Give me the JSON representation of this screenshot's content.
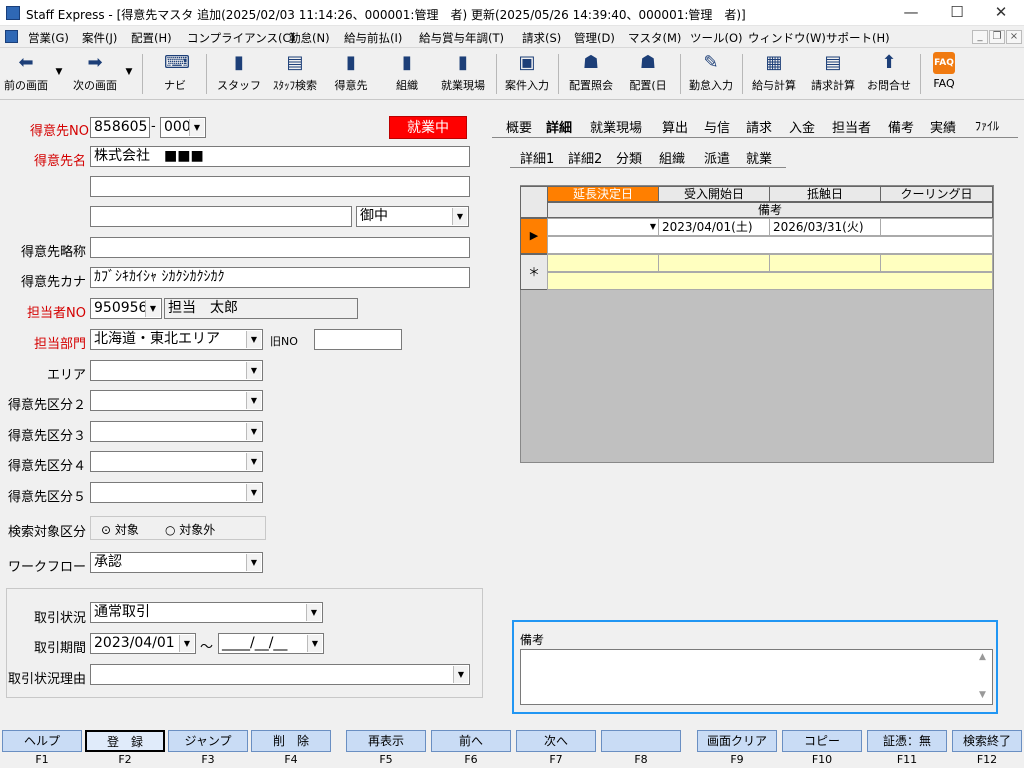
{
  "window": {
    "title": "Staff Express - [得意先マスタ 追加(2025/02/03 11:14:26、000001:管理　者) 更新(2025/05/26 14:39:40、000001:管理　者)]",
    "minimize": "—",
    "maximize": "☐",
    "close": "✕"
  },
  "menu": [
    "営業(G)",
    "案件(J)",
    "配置(H)",
    "コンプライアンス(C)",
    "勤怠(N)",
    "給与前払(I)",
    "給与賞与年調(T)",
    "請求(S)",
    "管理(D)",
    "マスタ(M)",
    "ツール(O)",
    "ウィンドウ(W)",
    "サポート(H)"
  ],
  "mdi": {
    "min": "_",
    "restore": "❐",
    "close": "×"
  },
  "toolbar": {
    "back": "前の画面",
    "forward": "次の画面",
    "navi": "ナビ",
    "staff": "スタッフ",
    "staff_search": "ｽﾀｯﾌ検索",
    "customer": "得意先",
    "org": "組織",
    "site": "就業現場",
    "job_input": "案件入力",
    "assign_view": "配置照会",
    "assign_day": "配置(日",
    "attendance": "勤怠入力",
    "payroll": "給与計算",
    "billing": "請求計算",
    "inquiry": "お問合せ",
    "faq": "FAQ",
    "faq_badge": "FAQ"
  },
  "form": {
    "cust_no_label": "得意先NO",
    "cust_no": "858605",
    "cust_sub": "000",
    "status_badge": "就業中",
    "name_label": "得意先名",
    "name": "株式会社　■■■",
    "name2": "",
    "name3": "",
    "honorific": "御中",
    "short_label": "得意先略称",
    "short": "",
    "kana_label": "得意先カナ",
    "kana": "ｶﾌﾞｼｷｶｲｼｬ ｼｶｸｼｶｸｼｶｸ",
    "rep_label": "担当者NO",
    "rep_no": "950956",
    "rep_name": "担当　太郎",
    "dept_label": "担当部門",
    "dept": "北海道・東北エリア",
    "old_no_label": "旧NO",
    "old_no": "",
    "area_label": "エリア",
    "cat2_label": "得意先区分２",
    "cat3_label": "得意先区分３",
    "cat4_label": "得意先区分４",
    "cat5_label": "得意先区分５",
    "search_label": "検索対象区分",
    "search_on": "対象",
    "search_off": "対象外",
    "workflow_label": "ワークフロー",
    "workflow": "承認",
    "deal_status_label": "取引状況",
    "deal_status": "通常取引",
    "deal_period_label": "取引期間",
    "deal_from": "2023/04/01",
    "tilde": "～",
    "deal_to": "____/__/__",
    "deal_reason_label": "取引状況理由",
    "deal_reason": ""
  },
  "tabs": [
    "概要",
    "詳細",
    "就業現場",
    "算出",
    "与信",
    "請求",
    "入金",
    "担当者",
    "備考",
    "実績",
    "ﾌｧｲﾙ"
  ],
  "subtabs": [
    "詳細1",
    "詳細2",
    "分類",
    "組織",
    "派遣",
    "就業"
  ],
  "grid": {
    "headers": [
      "延長決定日",
      "受入開始日",
      "抵触日",
      "クーリング日"
    ],
    "sub_header": "備考",
    "row": {
      "extend": "",
      "start": "2023/04/01(土)",
      "conflict": "2026/03/31(火)",
      "cooling": ""
    },
    "new_marker": "＊",
    "current_marker": "▶"
  },
  "remarks": {
    "label": "備考",
    "value": ""
  },
  "fkeys": [
    {
      "label": "ヘルプ",
      "key": "F1"
    },
    {
      "label": "登　録",
      "key": "F2"
    },
    {
      "label": "ジャンプ",
      "key": "F3"
    },
    {
      "label": "削　除",
      "key": "F4"
    },
    {
      "label": "再表示",
      "key": "F5"
    },
    {
      "label": "前へ",
      "key": "F6"
    },
    {
      "label": "次へ",
      "key": "F7"
    },
    {
      "label": "",
      "key": "F8"
    },
    {
      "label": "画面クリア",
      "key": "F9"
    },
    {
      "label": "コピー",
      "key": "F10"
    },
    {
      "label": "証憑：無",
      "key": "F11"
    },
    {
      "label": "検索終了",
      "key": "F12"
    }
  ],
  "colors": {
    "status_bg": "#ff0000",
    "selected_header": "#ff7f00",
    "new_row": "#ffffc0",
    "fkey": "#c9dcf5",
    "focus": "#2196f3",
    "grid_bg": "#c0c0c0"
  }
}
